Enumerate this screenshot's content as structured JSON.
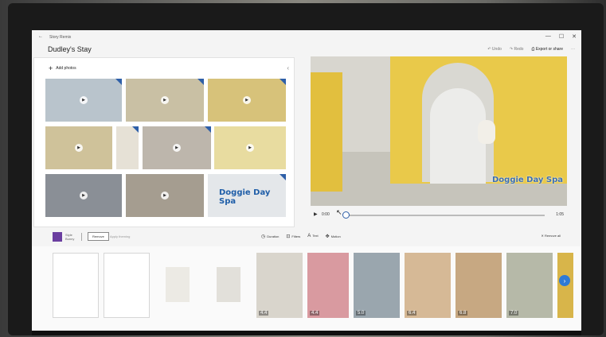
{
  "window": {
    "app_name": "Story Remix",
    "back_glyph": "←",
    "controls": [
      "—",
      "☐",
      "✕"
    ]
  },
  "header": {
    "project_title": "Dudley's Stay",
    "undo_label": "Undo",
    "redo_label": "Redo",
    "export_label": "Export or share",
    "more_glyph": "···"
  },
  "library": {
    "add_photos_label": "Add photos",
    "collapse_glyph": "‹",
    "title_card_text": "Doggie Day Spa",
    "thumbnails": [
      {
        "color": "#b9c4cc",
        "play": true
      },
      {
        "color": "#c9c0a4",
        "play": true
      },
      {
        "color": "#d7c27a",
        "play": true
      },
      {
        "color": "#cfc29a",
        "play": true
      },
      {
        "color": "#e6e1d6",
        "play": false
      },
      {
        "color": "#bdb6ac",
        "play": true
      },
      {
        "color": "#e8dca0",
        "play": true
      },
      {
        "color": "#8a8f96",
        "play": true
      },
      {
        "color": "#a59d90",
        "play": true
      },
      {
        "color": "#e4e7ea",
        "play": false
      }
    ]
  },
  "preview": {
    "watermark_text": "Doggie Day Spa",
    "current_time": "0:00",
    "total_time": "1:05",
    "progress": 0.0
  },
  "toolbar": {
    "theme_label_1": "Style",
    "theme_label_2": "Bunny",
    "remove_label": "Remove",
    "apply_label": "Apply theming",
    "tools": [
      {
        "icon": "◷",
        "label": "Duration"
      },
      {
        "icon": "⊡",
        "label": "Filters"
      },
      {
        "icon": "A",
        "label": "Text"
      },
      {
        "icon": "✥",
        "label": "Motion"
      }
    ],
    "remove_all_label": "Remove all"
  },
  "storyboard": {
    "cards": [
      {
        "type": "blank",
        "duration": "",
        "color": "#ffffff"
      },
      {
        "type": "blank",
        "duration": "",
        "color": "#ffffff"
      },
      {
        "type": "faded",
        "duration": "",
        "color": "#eceae4"
      },
      {
        "type": "faded",
        "duration": "",
        "color": "#e2e0da"
      },
      {
        "type": "photo",
        "duration": "4.4",
        "color": "#d9d5cc"
      },
      {
        "type": "photo",
        "duration": "4.4",
        "color": "#d99aa0"
      },
      {
        "type": "photo",
        "duration": "5.0",
        "color": "#9aa6ae"
      },
      {
        "type": "photo",
        "duration": "6.4",
        "color": "#d6b996"
      },
      {
        "type": "photo",
        "duration": "6.8",
        "color": "#c7a882"
      },
      {
        "type": "photo",
        "duration": "7.0",
        "color": "#b6b9a8"
      },
      {
        "type": "photo",
        "duration": "",
        "color": "#d8b54a"
      }
    ],
    "next_glyph": "›"
  },
  "colors": {
    "accent": "#2e5fa8",
    "theme": "#6b3fa0",
    "next_button": "#2e7ad6"
  }
}
